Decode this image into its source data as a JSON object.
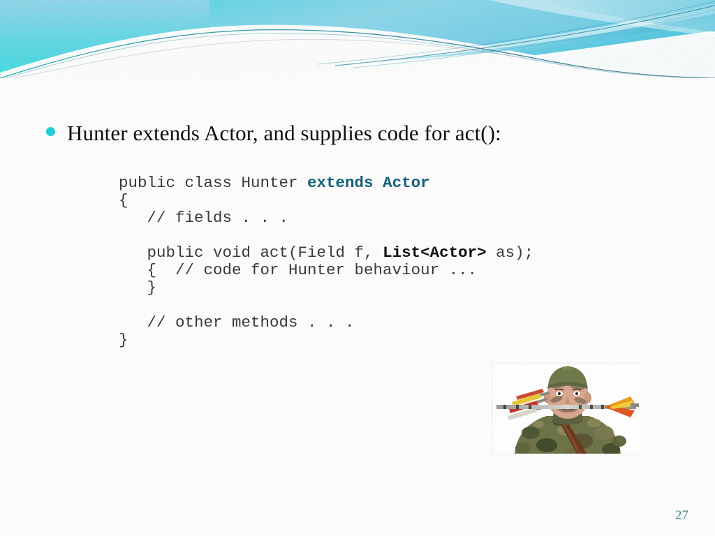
{
  "slide": {
    "number": "27",
    "background_color": "#fdfdfd",
    "accent_color": "#21d0d6",
    "banner_gradient_from": "#8fd3e8",
    "banner_gradient_to": "#4fd8e0",
    "code_keyword_color": "#14627a"
  },
  "heading": {
    "bullet_icon": "bullet-dot-icon",
    "text": "Hunter extends Actor, and supplies code for act():"
  },
  "code": {
    "lines": [
      {
        "segments": [
          {
            "text": "public class Hunter ",
            "style": "plain"
          },
          {
            "text": "extends Actor",
            "style": "teal-bold"
          }
        ]
      },
      {
        "segments": [
          {
            "text": "{",
            "style": "plain"
          }
        ]
      },
      {
        "segments": [
          {
            "text": "   // fields . . .",
            "style": "plain"
          }
        ]
      },
      {
        "segments": []
      },
      {
        "segments": [
          {
            "text": "   public void act(Field f, ",
            "style": "plain"
          },
          {
            "text": "List<Actor>",
            "style": "bold"
          },
          {
            "text": " as);",
            "style": "plain"
          }
        ]
      },
      {
        "segments": [
          {
            "text": "   {  // code for Hunter behaviour ...",
            "style": "plain"
          }
        ]
      },
      {
        "segments": [
          {
            "text": "   }",
            "style": "plain"
          }
        ]
      },
      {
        "segments": []
      },
      {
        "segments": [
          {
            "text": "   // other methods . . .",
            "style": "plain"
          }
        ]
      },
      {
        "segments": [
          {
            "text": "}",
            "style": "plain"
          }
        ]
      }
    ]
  },
  "image": {
    "name": "hunter-photo",
    "alt": "Photograph of a hunter wearing camouflage clothing, a green cap and face paint, with a quiver of arrows and an arrow crossing the frame"
  }
}
